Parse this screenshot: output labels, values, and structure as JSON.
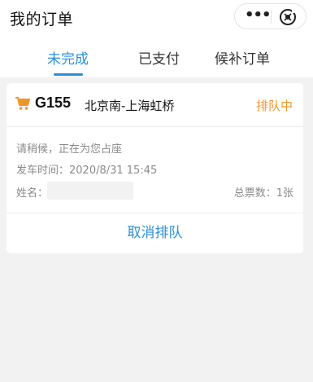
{
  "header": {
    "title": "我的订单",
    "more_label": "•••"
  },
  "tabs": [
    {
      "label": "未完成",
      "active": true
    },
    {
      "label": "已支付",
      "active": false
    },
    {
      "label": "候补订单",
      "active": false
    }
  ],
  "order": {
    "train_no": "G155",
    "route": "北京南-上海虹桥",
    "status": "排队中",
    "message": "请稍候，正在为您占座",
    "departure": "发车时间：2020/8/31 15:45",
    "name_label": "姓名：",
    "ticket_count": "总票数：1张",
    "cancel_label": "取消排队"
  },
  "colors": {
    "accent": "#2a8fd6",
    "status": "#f0952a",
    "icon": "#f0952a"
  },
  "icons": {
    "cart": "cart-icon",
    "close": "close-icon",
    "more": "more-icon"
  }
}
